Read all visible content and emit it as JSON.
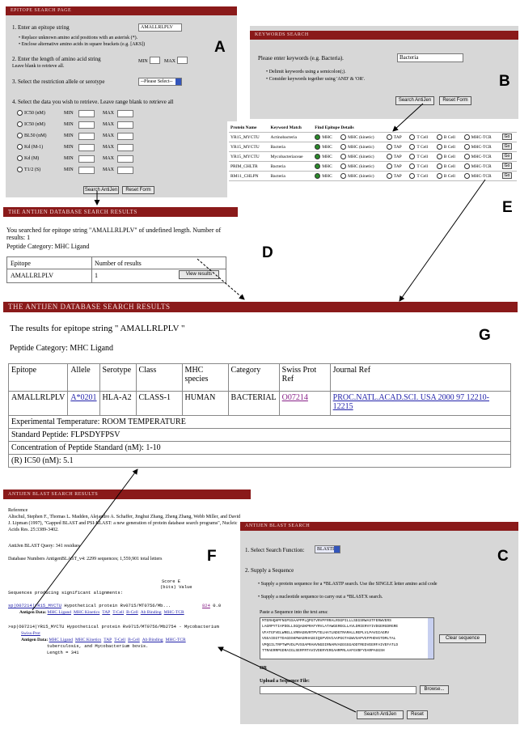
{
  "labels": {
    "A": "A",
    "B": "B",
    "C": "C",
    "D": "D",
    "E": "E",
    "F": "F",
    "G": "G"
  },
  "panelA": {
    "header": "EPITOPE SEARCH PAGE",
    "step1": "1. Enter an epitope string",
    "step1_value": "AMALLRLPLV",
    "step1_note1": "Replace unknown amino acid positions with an asterisk (*).",
    "step1_note2": "Enclose alternative amino acids in square brackets (e.g. [AKS])",
    "step2": "2. Enter the length of amino acid string",
    "step2_note": "Leave blank to retrieve all.",
    "min": "MIN",
    "max": "MAX",
    "step3": "3. Select the restriction allele or serotype",
    "step3_select": "--Please Select--",
    "step4": "4. Select the data you wish to retrieve. Leave range blank to retrieve all",
    "measures": [
      "IC50 (nM)",
      "IC50 (nM)",
      "BL50 (nM)",
      "Kd (M-1)",
      "Kd (M)",
      "T1/2 (S)"
    ],
    "search_btn": "Search AntiJen",
    "reset_btn": "Reset Form"
  },
  "panelB": {
    "header": "KEYWORDS SEARCH",
    "prompt": "Please enter keywords (e.g. Bacteria).",
    "value": "Bacteria",
    "note1": "Delimit keywords using a semicolon(;).",
    "note2": "Consider keywords together using 'AND' & 'OR'.",
    "search_btn": "Search AntiJen",
    "reset_btn": "Reset Form"
  },
  "panelE": {
    "headers": [
      "Protein Name",
      "Keyword Match",
      "Find Epitope Details"
    ],
    "options": [
      "MHC",
      "MHC (kinetic)",
      "TAP",
      "T Cell",
      "B Cell",
      "MHC-TCR"
    ],
    "go": "Go",
    "rows": [
      {
        "protein": "YR15_MYCTU",
        "keyword": "Actinobacteria"
      },
      {
        "protein": "YR15_MYCTU",
        "keyword": "Bacteria"
      },
      {
        "protein": "YR15_MYCTU",
        "keyword": "Mycobacteriaceae"
      },
      {
        "protein": "PRIM_CHLTR",
        "keyword": "Bacteria"
      },
      {
        "protein": "RM11_CHLPN",
        "keyword": "Bacteria"
      }
    ]
  },
  "panelD": {
    "header": "THE ANTIJEN DATABASE SEARCH RESULTS",
    "line1": "You searched for epitope string \"AMALLRLPLV\" of undefined length. Number of results: 1",
    "category": "Peptide Category: MHC Ligand",
    "col1": "Epitope",
    "col2": "Number of results",
    "epitope": "AMALLRLPLV",
    "count": "1",
    "view_btn": "View results"
  },
  "panelG": {
    "header": "THE ANTIJEN DATABASE SEARCH RESULTS",
    "line1": "The results for epitope string \" AMALLRLPLV \"",
    "category": "Peptide Category: MHC Ligand",
    "cols": [
      "Epitope",
      "Allele",
      "Serotype",
      "Class",
      "MHC species",
      "Category",
      "Swiss Prot Ref",
      "Journal Ref"
    ],
    "row": [
      "AMALLRLPLV",
      "A*0201",
      "HLA-A2",
      "CLASS-1",
      "HUMAN",
      "BACTERIAL",
      "O07214",
      "PROC.NATL.ACAD.SCI. USA 2000 97 12210-12215"
    ],
    "exp_temp": "Experimental Temperature: ROOM TEMPERATURE",
    "std_pep": "Standard Peptide: FLPSDYFPSV",
    "conc": "Concentration of Peptide Standard (nM): 1-10",
    "ic50": "(R) IC50 (nM): 5.1"
  },
  "panelF": {
    "header": "ANTIJEN BLAST SEARCH RESULTS",
    "ref_label": "Reference",
    "ref_text": "Altschul, Stephen F., Thomas L. Madden, Alejandro A. Schaffer, Jinghui Zhang, Zheng Zhang, Webb Miller, and David J. Lipman (1997), \"Gapped BLAST and PSI-BLAST: a new generation of protein database search programs\", Nucleic Acids Res. 25:3389-3402.",
    "query": "AntiJen BLAST Query: 341 residues",
    "database": "Database Numbers AntigenBLAST_v4: 2299 sequences; 1,559,901 total letters",
    "col_header": "Sequences producing significant alignments:",
    "score_head": "Score   E",
    "score_head2": "(bits) Value",
    "hit1_id": "sp|O07214|YR15_MYCTU",
    "hit1_desc": "Hypothetical protein Rv0715/MT0756/Mb...",
    "hit1_score": "824",
    "hit1_e": "0.0",
    "antigen_label": "Antigen Data:",
    "antigen_links": [
      "MHC Ligand",
      "MHC Kinetics",
      "TAP",
      "T-Cell",
      "B-Cell",
      "Ab Binding",
      "MHC-TCR"
    ],
    "hit2_line": ">sp|O07214|YR15_MYCTU Hypothetical protein Rv0715/MT0756/Mb2754 - Mycobacterium",
    "hit2_link": "Swiss-Prot",
    "hit2_line2": "tuberculosis, and Mycobacterium bovis.",
    "hit2_len": "Length = 341"
  },
  "panelC": {
    "header": "ANTIJEN BLAST SEARCH",
    "step1": "1. Select Search Function:",
    "step1_value": "BLASTP",
    "step2": "2. Supply a Sequence",
    "bullet1": "Supply a protein sequence for a *BLASTP search. Use the SINGLE letter amino acid code",
    "bullet2": "Supply a nucleotide sequence to carry out a *BLASTX search.",
    "paste_label": "Paste a Sequence into the text area:",
    "sequence_lines": [
      "MTERHQHPFNGPSSAAPPPLQPGTVRVPFRRALRSGPILLLSEGSRWASTFERWVERS",
      "LAGRPYTIAPDDLLSGQAGKPRAFYRVLATAWGEREGLLAVLDRIERVYIVDGERGDRGRE",
      "VFATGFVELWRELLVRRAGNVRTPVTELHATLNDGTRAMALLREPLVLPAVGIAGRV",
      "VGEAIEGTTDAGDSKPWAGRHAGEIQGPVDVIAAPGGTAGWVSAPVGFPHDVGTDMLTAL",
      "VPQGILTRPTWPVDLPVSSAPRAHVNGDIRNARVAEEGGGADDTREDVEERFAIVEFATLD",
      "TTRAERRPGDRAIGLSERFRTAVIVDERYERGAHRPRLAAFGVBFYDARPAGGSH"
    ],
    "clear_btn": "Clear sequence",
    "or": "OR",
    "upload_label": "Upload a Sequence File:",
    "browse_btn": "Browse...",
    "search_btn": "Search AntiJen",
    "reset_btn": "Reset"
  }
}
